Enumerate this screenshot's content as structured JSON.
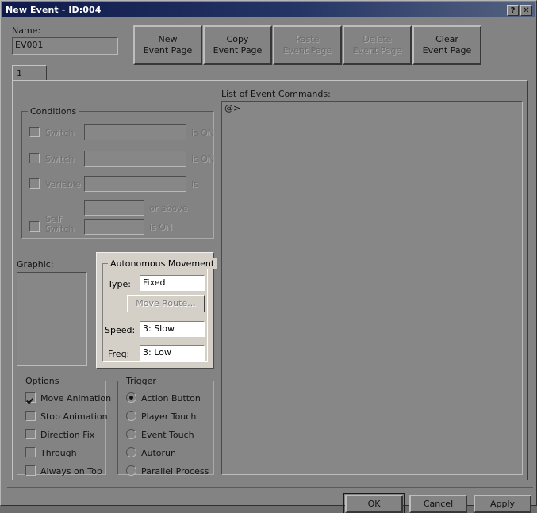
{
  "window": {
    "title": "New Event - ID:004",
    "help_button": "?",
    "close_button": "✕"
  },
  "name_section": {
    "label": "Name:",
    "value": "EV001",
    "placeholder": ""
  },
  "page_buttons": [
    {
      "label": "New\nEvent Page",
      "enabled": true
    },
    {
      "label": "Copy\nEvent Page",
      "enabled": true
    },
    {
      "label": "Paste\nEvent Page",
      "enabled": false
    },
    {
      "label": "Delete\nEvent Page",
      "enabled": false
    },
    {
      "label": "Clear\nEvent Page",
      "enabled": true
    }
  ],
  "tabs": [
    {
      "label": "1",
      "selected": true
    }
  ],
  "conditions": {
    "title": "Conditions",
    "rows": [
      {
        "label": "Switch",
        "checked": false,
        "value": "",
        "suffix": "is ON",
        "control": "field-ellipsis"
      },
      {
        "label": "Switch",
        "checked": false,
        "value": "",
        "suffix": "is ON",
        "control": "field-ellipsis"
      },
      {
        "label": "Variable",
        "checked": false,
        "value": "",
        "suffix": "is",
        "control": "field-ellipsis"
      },
      {
        "label": "",
        "checked": null,
        "value": "",
        "suffix": "or above",
        "control": "spinner"
      },
      {
        "label": "Self\nSwitch",
        "checked": false,
        "value": "",
        "suffix": "is ON",
        "control": "dropdown"
      }
    ]
  },
  "graphic": {
    "label": "Graphic:",
    "value": ""
  },
  "autonomous_movement": {
    "title": "Autonomous Movement",
    "type_label": "Type:",
    "type_value": "Fixed",
    "move_route_label": "Move Route...",
    "move_route_enabled": false,
    "speed_label": "Speed:",
    "speed_value": "3: Slow",
    "freq_label": "Freq:",
    "freq_value": "3: Low"
  },
  "options": {
    "title": "Options",
    "items": [
      {
        "label": "Move Animation",
        "checked": true
      },
      {
        "label": "Stop Animation",
        "checked": false
      },
      {
        "label": "Direction Fix",
        "checked": false
      },
      {
        "label": "Through",
        "checked": false
      },
      {
        "label": "Always on Top",
        "checked": false
      }
    ]
  },
  "trigger": {
    "title": "Trigger",
    "items": [
      {
        "label": "Action Button",
        "selected": true
      },
      {
        "label": "Player Touch",
        "selected": false
      },
      {
        "label": "Event Touch",
        "selected": false
      },
      {
        "label": "Autorun",
        "selected": false
      },
      {
        "label": "Parallel Process",
        "selected": false
      }
    ]
  },
  "command_list": {
    "label": "List of Event Commands:",
    "lines": [
      "@>"
    ]
  },
  "footer_buttons": [
    {
      "label": "OK",
      "default": true
    },
    {
      "label": "Cancel",
      "default": false
    },
    {
      "label": "Apply",
      "default": false
    }
  ],
  "colors": {
    "window_bg": "#838383",
    "title_left": "#0f1a4a",
    "title_right": "#54627f",
    "panel_light": "#d4d0c8",
    "field_bg": "#878787",
    "combo_bg": "#ffffff"
  }
}
